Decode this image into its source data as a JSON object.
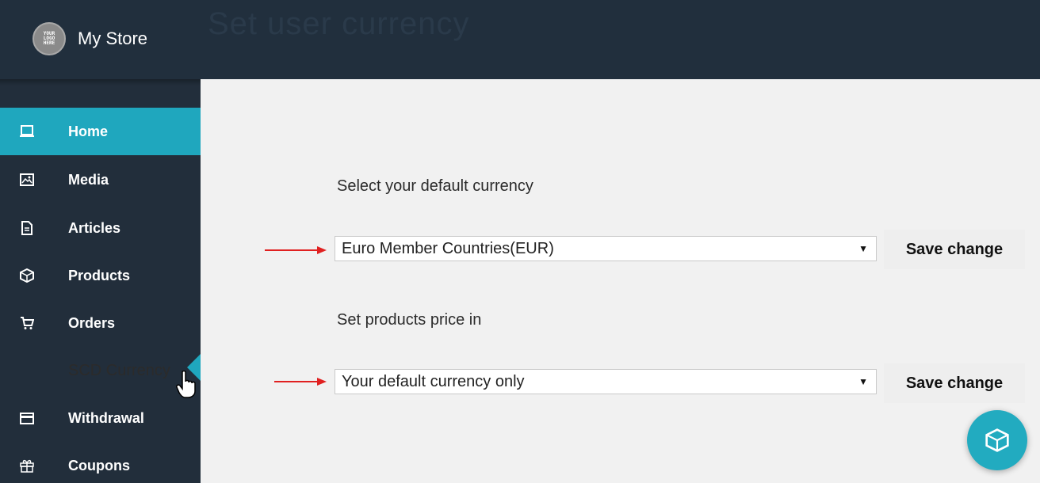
{
  "header": {
    "logo_text": "YOUR LOGO HERE",
    "store_name": "My Store",
    "page_title": "Set user currency"
  },
  "sidebar": {
    "items": [
      {
        "label": "Home",
        "icon": "laptop-icon",
        "active": true
      },
      {
        "label": "Media",
        "icon": "image-icon"
      },
      {
        "label": "Articles",
        "icon": "document-icon"
      },
      {
        "label": "Products",
        "icon": "cube-icon"
      },
      {
        "label": "Orders",
        "icon": "cart-icon"
      },
      {
        "label": "SCD Currency",
        "icon": "",
        "sub": true
      },
      {
        "label": "Withdrawal",
        "icon": "credit-card-icon"
      },
      {
        "label": "Coupons",
        "icon": "gift-icon"
      }
    ]
  },
  "main": {
    "default_currency_label": "Select your default currency",
    "default_currency_value": "Euro Member Countries(EUR)",
    "price_label": "Set products price in",
    "price_value": "Your default currency only",
    "save_label": "Save change"
  },
  "colors": {
    "accent": "#1fa7be",
    "sidebar_bg": "#222e3b",
    "arrow": "#e02020"
  }
}
